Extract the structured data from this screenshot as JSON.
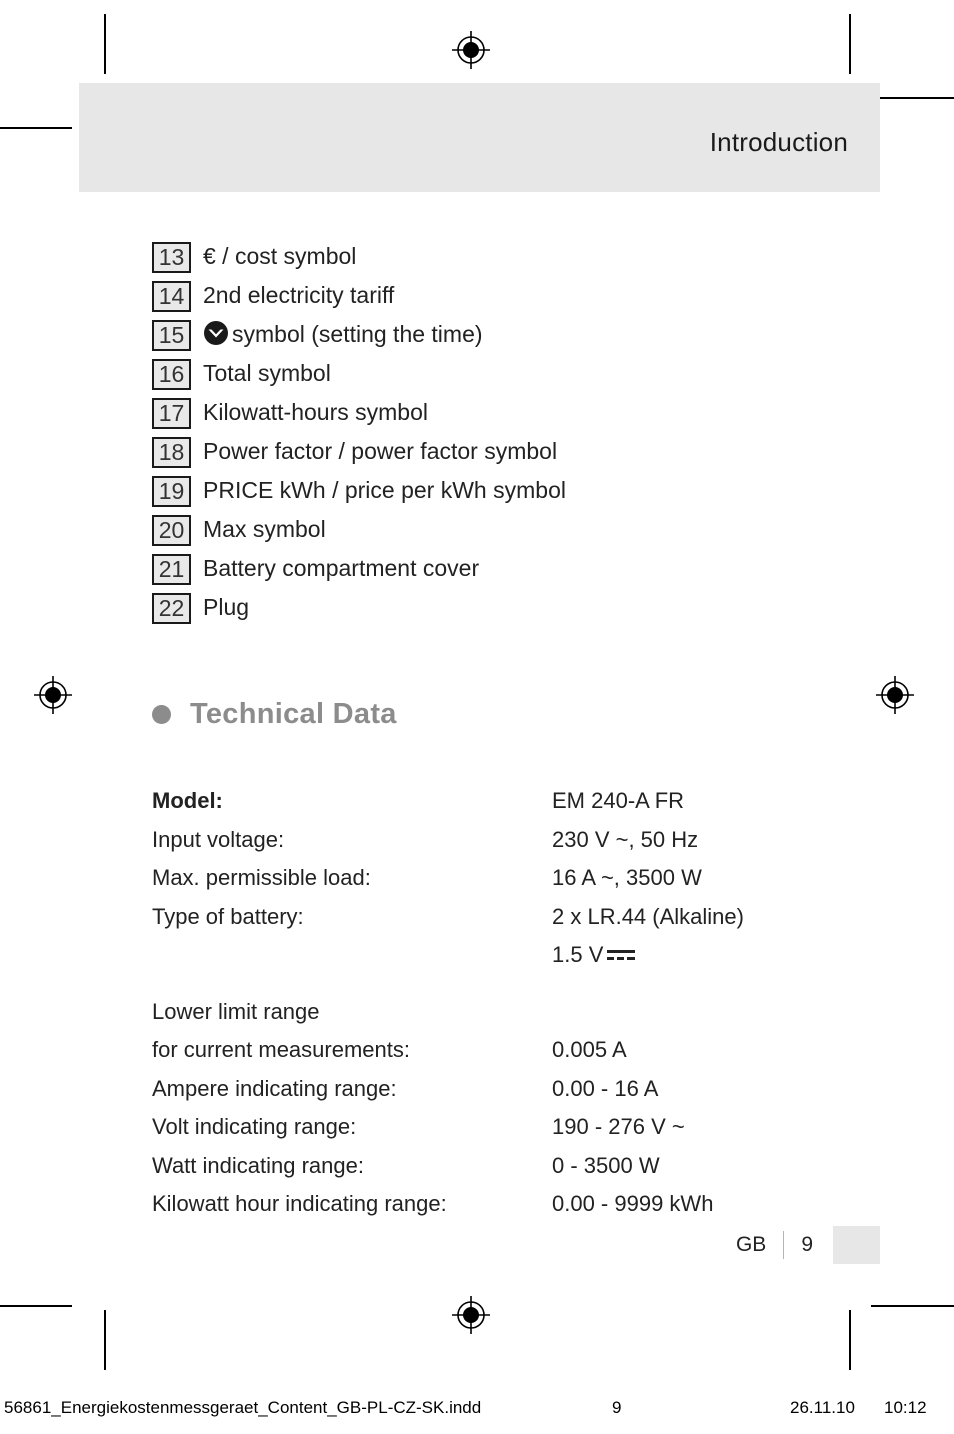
{
  "header": {
    "title": "Introduction"
  },
  "legend": {
    "items": [
      {
        "num": "13",
        "text": "€ / cost symbol",
        "icon": null
      },
      {
        "num": "14",
        "text": "2nd electricity tariff",
        "icon": null
      },
      {
        "num": "15",
        "text": "symbol (setting the time)",
        "icon": "clock-symbol"
      },
      {
        "num": "16",
        "text": "Total symbol",
        "icon": null
      },
      {
        "num": "17",
        "text": "Kilowatt-hours symbol",
        "icon": null
      },
      {
        "num": "18",
        "text": "Power factor / power factor symbol",
        "icon": null
      },
      {
        "num": "19",
        "text": "PRICE kWh / price per kWh symbol",
        "icon": null
      },
      {
        "num": "20",
        "text": "Max symbol",
        "icon": null
      },
      {
        "num": "21",
        "text": "Battery compartment cover",
        "icon": null
      },
      {
        "num": "22",
        "text": "Plug",
        "icon": null
      }
    ]
  },
  "section": {
    "heading": "Technical Data",
    "bullet_color": "#8c8c8c"
  },
  "tech_data": {
    "rows": [
      {
        "label": "Model:",
        "value": "EM 240-A FR",
        "bold": true,
        "dc": false
      },
      {
        "label": "Input voltage:",
        "value": "230 V ~, 50 Hz",
        "bold": false,
        "dc": false
      },
      {
        "label": "Max. permissible load:",
        "value": "16 A ~, 3500 W",
        "bold": false,
        "dc": false
      },
      {
        "label": "Type of battery:",
        "value": "2 x LR.44 (Alkaline)",
        "bold": false,
        "dc": false
      },
      {
        "label": "",
        "value": "1.5 V",
        "bold": false,
        "dc": true
      },
      {
        "label": "Lower limit range",
        "value": "",
        "bold": false,
        "dc": false
      },
      {
        "label": "for current measurements:",
        "value": "0.005 A",
        "bold": false,
        "dc": false
      },
      {
        "label": "Ampere indicating range:",
        "value": "0.00 - 16 A",
        "bold": false,
        "dc": false
      },
      {
        "label": "Volt indicating range:",
        "value": "190 - 276 V ~",
        "bold": false,
        "dc": false
      },
      {
        "label": "Watt indicating range:",
        "value": "0 - 3500 W",
        "bold": false,
        "dc": false
      },
      {
        "label": "Kilowatt hour indicating range:",
        "value": "0.00 - 9999 kWh",
        "bold": false,
        "dc": false
      }
    ]
  },
  "footer": {
    "locale": "GB",
    "page_number": "9"
  },
  "slug": {
    "filename": "56861_Energiekostenmessgeraet_Content_GB-PL-CZ-SK.indd",
    "page": "9",
    "date": "26.11.10",
    "time": "10:12"
  },
  "colors": {
    "band": "#e7e7e7",
    "text": "#1a1a1a",
    "heading": "#8c8c8c"
  }
}
